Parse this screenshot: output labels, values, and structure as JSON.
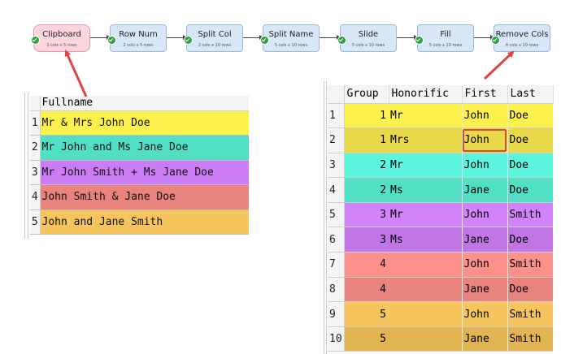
{
  "pipeline": {
    "nodes": [
      {
        "title": "Clipboard",
        "sub": "1 cols x 5 rows",
        "active": true
      },
      {
        "title": "Row Num",
        "sub": "2 cols x 5 rows",
        "active": false
      },
      {
        "title": "Split Col",
        "sub": "2 cols x 10 rows",
        "active": false
      },
      {
        "title": "Split Name",
        "sub": "5 cols x 10 rows",
        "active": false
      },
      {
        "title": "Slide",
        "sub": "5 cols x 10 rows",
        "active": false
      },
      {
        "title": "Fill",
        "sub": "5 cols x 10 rows",
        "active": false
      },
      {
        "title": "Remove Cols",
        "sub": "4 cols x 10 rows",
        "active": false
      }
    ]
  },
  "left_table": {
    "header": "Fullname",
    "rows": [
      {
        "num": "1",
        "value": "Mr & Mrs John Doe",
        "color": "#fdf24d"
      },
      {
        "num": "2",
        "value": "Mr John and Ms Jane Doe",
        "color": "#52e0c4"
      },
      {
        "num": "3",
        "value": "Mr John Smith + Ms Jane Doe",
        "color": "#cc7df6"
      },
      {
        "num": "4",
        "value": "John Smith & Jane Doe",
        "color": "#e8837d"
      },
      {
        "num": "5",
        "value": "John and Jane Smith",
        "color": "#f7c55e"
      }
    ]
  },
  "right_table": {
    "headers": [
      "Group",
      "Honorific",
      "First",
      "Last"
    ],
    "rows": [
      {
        "num": "1",
        "group": "1",
        "honorific": "Mr",
        "first": "John",
        "last": "Doe",
        "color": "#fdf24d",
        "selected": false
      },
      {
        "num": "2",
        "group": "1",
        "honorific": "Mrs",
        "first": "John",
        "last": "Doe",
        "color": "#e8d94a",
        "selected": true
      },
      {
        "num": "3",
        "group": "2",
        "honorific": "Mr",
        "first": "John",
        "last": "Doe",
        "color": "#5bf5dd",
        "selected": false
      },
      {
        "num": "4",
        "group": "2",
        "honorific": "Ms",
        "first": "Jane",
        "last": "Doe",
        "color": "#52e0c4",
        "selected": false
      },
      {
        "num": "5",
        "group": "3",
        "honorific": "Mr",
        "first": "John",
        "last": "Smith",
        "color": "#d383fa",
        "selected": false
      },
      {
        "num": "6",
        "group": "3",
        "honorific": "Ms",
        "first": "Jane",
        "last": "Doe",
        "color": "#c077e5",
        "selected": false
      },
      {
        "num": "7",
        "group": "4",
        "honorific": "",
        "first": "John",
        "last": "Smith",
        "color": "#fc918b",
        "selected": false
      },
      {
        "num": "8",
        "group": "4",
        "honorific": "",
        "first": "Jane",
        "last": "Doe",
        "color": "#e8837d",
        "selected": false
      },
      {
        "num": "9",
        "group": "5",
        "honorific": "",
        "first": "John",
        "last": "Smith",
        "color": "#f7c55e",
        "selected": false
      },
      {
        "num": "10",
        "group": "5",
        "honorific": "",
        "first": "Jane",
        "last": "Smith",
        "color": "#e3b552",
        "selected": false
      }
    ]
  },
  "colors": {
    "arrow": "#e0463e",
    "node_fill": "#d7e7f8",
    "node_active_fill": "#fcd5df",
    "check": "#2ea043"
  }
}
